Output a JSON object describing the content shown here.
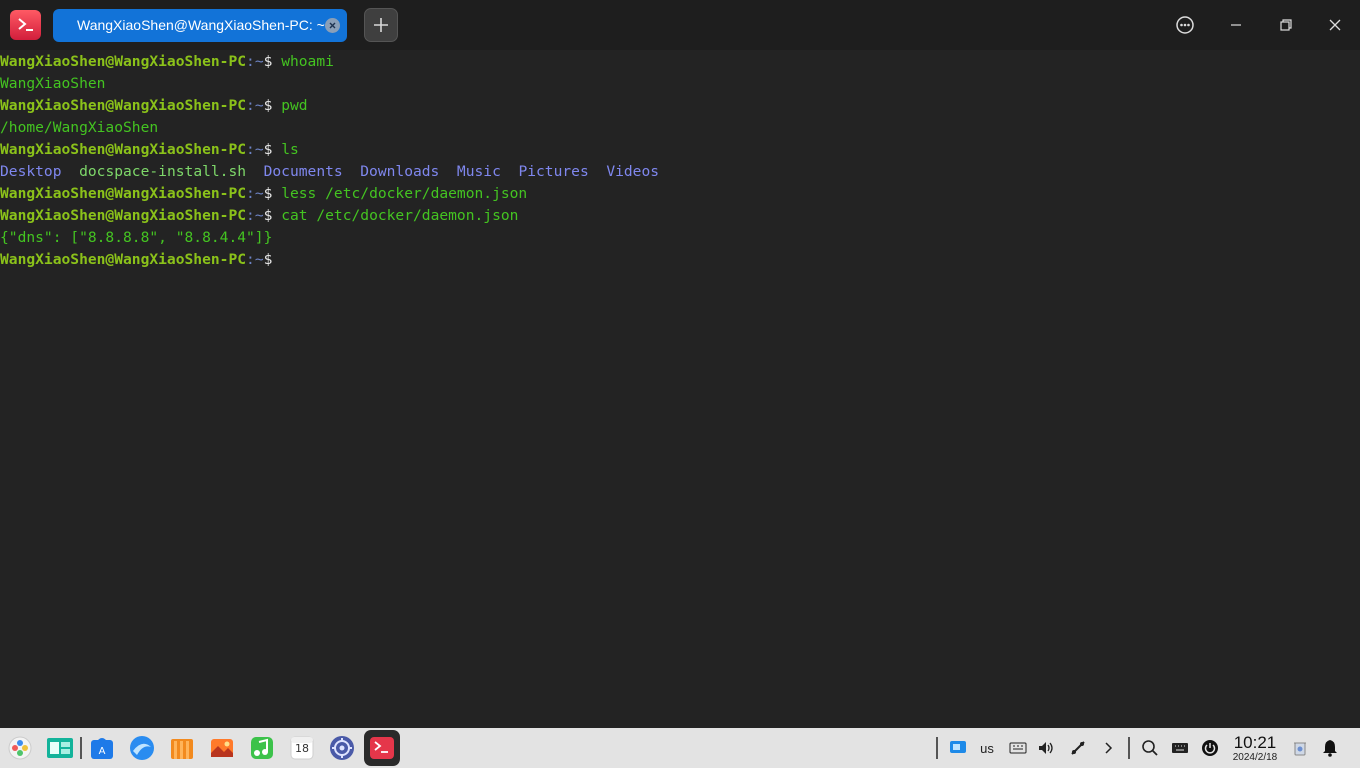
{
  "window": {
    "tab_title": "WangXiaoShen@WangXiaoShen-PC: ~",
    "app_icon": "terminal-icon",
    "tab_close_icon": "close-icon",
    "add_tab_icon": "plus-icon",
    "menu_icon": "more-options-icon",
    "minimize_icon": "minimize-icon",
    "maximize_icon": "restore-icon",
    "close_icon": "close-icon"
  },
  "prompt": {
    "user_host": "WangXiaoShen@WangXiaoShen-PC",
    "colon": ":",
    "path": "~",
    "dollar": "$"
  },
  "terminal": {
    "cmd1": "whoami",
    "out1": "WangXiaoShen",
    "cmd2": "pwd",
    "out2": "/home/WangXiaoShen",
    "cmd3": "ls",
    "ls_entries": [
      "Desktop",
      "docspace-install.sh",
      "Documents",
      "Downloads",
      "Music",
      "Pictures",
      "Videos"
    ],
    "cmd4": "less /etc/docker/daemon.json",
    "cmd5": "cat /etc/docker/daemon.json",
    "out5": "{\"dns\": [\"8.8.8.8\", \"8.8.4.4\"]}"
  },
  "taskbar": {
    "dock": [
      "launcher-icon",
      "multitasking-icon",
      "app-store-icon",
      "browser-icon",
      "file-manager-icon",
      "image-viewer-icon",
      "music-icon",
      "calendar-icon",
      "settings-icon",
      "terminal-icon"
    ],
    "calendar_day": "18",
    "keyboard_layout": "us",
    "clock_time": "10:21",
    "clock_date": "2024/2/18"
  },
  "colors": {
    "tab_active": "#1273d8",
    "prompt_user": "#8bc21a",
    "prompt_path": "#6d83c4",
    "command_text": "#44c421",
    "directory": "#7f87ee",
    "executable": "#7ed86a",
    "terminal_bg": "#232323"
  }
}
